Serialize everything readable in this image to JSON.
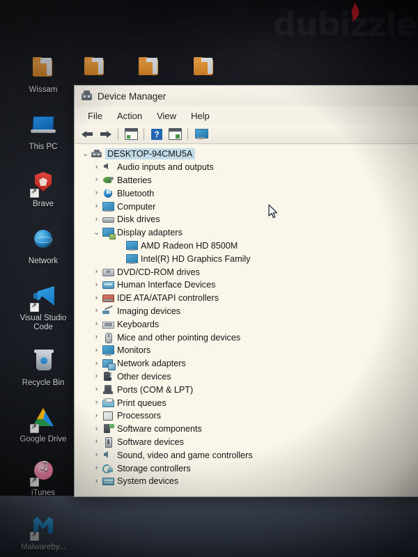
{
  "watermark": {
    "text": "dubizzle"
  },
  "desktop": {
    "top_folders": [
      {
        "name": "folder-icon-1",
        "label": ""
      },
      {
        "name": "folder-icon-2",
        "label": ""
      },
      {
        "name": "folder-icon-3",
        "label": ""
      },
      {
        "name": "folder-icon-4",
        "label": ""
      }
    ],
    "icons": [
      {
        "label": "Wissam",
        "icon": "folder-icon",
        "shortcut": false
      },
      {
        "label": "This PC",
        "icon": "this-pc-icon",
        "shortcut": false
      },
      {
        "label": "Brave",
        "icon": "brave-browser-icon",
        "shortcut": true
      },
      {
        "label": "Network",
        "icon": "network-icon",
        "shortcut": false
      },
      {
        "label": "Visual Studio Code",
        "icon": "visual-studio-code-icon",
        "shortcut": true
      },
      {
        "label": "Recycle Bin",
        "icon": "recycle-bin-icon",
        "shortcut": false
      },
      {
        "label": "Google Drive",
        "icon": "google-drive-icon",
        "shortcut": true
      },
      {
        "label": "iTunes",
        "icon": "itunes-icon",
        "shortcut": true
      },
      {
        "label": "Malwareby...",
        "icon": "malwarebytes-icon",
        "shortcut": true
      }
    ]
  },
  "window": {
    "title": "Device Manager",
    "title_icon": "device-manager-icon",
    "menu": [
      {
        "label": "File"
      },
      {
        "label": "Action"
      },
      {
        "label": "View"
      },
      {
        "label": "Help"
      }
    ],
    "toolbar": [
      {
        "name": "back-arrow-icon",
        "glyph": "back"
      },
      {
        "name": "forward-arrow-icon",
        "glyph": "forward"
      },
      {
        "name": "toolbar-separator-1",
        "glyph": "sep"
      },
      {
        "name": "properties-icon",
        "glyph": "props"
      },
      {
        "name": "toolbar-separator-2",
        "glyph": "sep"
      },
      {
        "name": "help-icon",
        "glyph": "help",
        "text": "?"
      },
      {
        "name": "update-driver-icon",
        "glyph": "update"
      },
      {
        "name": "toolbar-separator-3",
        "glyph": "sep"
      },
      {
        "name": "scan-hardware-changes-icon",
        "glyph": "scan"
      }
    ]
  },
  "tree": {
    "root": {
      "label": "DESKTOP-94CMU5A",
      "icon": "computer-root-icon",
      "expanded": true,
      "selected": true
    },
    "nodes": [
      {
        "label": "Audio inputs and outputs",
        "icon": "g-speaker",
        "expanded": false,
        "level": 1
      },
      {
        "label": "Batteries",
        "icon": "g-battery",
        "expanded": false,
        "level": 1
      },
      {
        "label": "Bluetooth",
        "icon": "g-bt",
        "expanded": false,
        "level": 1
      },
      {
        "label": "Computer",
        "icon": "g-computer",
        "expanded": false,
        "level": 1
      },
      {
        "label": "Disk drives",
        "icon": "g-disk",
        "expanded": false,
        "level": 1
      },
      {
        "label": "Display adapters",
        "icon": "g-dispadp",
        "expanded": true,
        "level": 1
      },
      {
        "label": "AMD Radeon HD 8500M",
        "icon": "g-monitor",
        "expanded": null,
        "level": 2
      },
      {
        "label": "Intel(R) HD Graphics Family",
        "icon": "g-monitor",
        "expanded": null,
        "level": 2
      },
      {
        "label": "DVD/CD-ROM drives",
        "icon": "g-dvd",
        "expanded": false,
        "level": 1
      },
      {
        "label": "Human Interface Devices",
        "icon": "g-hid",
        "expanded": false,
        "level": 1
      },
      {
        "label": "IDE ATA/ATAPI controllers",
        "icon": "g-ide",
        "expanded": false,
        "level": 1
      },
      {
        "label": "Imaging devices",
        "icon": "g-imaging",
        "expanded": false,
        "level": 1
      },
      {
        "label": "Keyboards",
        "icon": "g-keyboard",
        "expanded": false,
        "level": 1
      },
      {
        "label": "Mice and other pointing devices",
        "icon": "g-mouse",
        "expanded": false,
        "level": 1
      },
      {
        "label": "Monitors",
        "icon": "g-monitor",
        "expanded": false,
        "level": 1
      },
      {
        "label": "Network adapters",
        "icon": "g-netadp",
        "expanded": false,
        "level": 1
      },
      {
        "label": "Other devices",
        "icon": "g-other",
        "expanded": false,
        "level": 1
      },
      {
        "label": "Ports (COM & LPT)",
        "icon": "g-port",
        "expanded": false,
        "level": 1
      },
      {
        "label": "Print queues",
        "icon": "g-printq",
        "expanded": false,
        "level": 1
      },
      {
        "label": "Processors",
        "icon": "g-proc",
        "expanded": false,
        "level": 1
      },
      {
        "label": "Software components",
        "icon": "g-softcomp",
        "expanded": false,
        "level": 1
      },
      {
        "label": "Software devices",
        "icon": "g-softdev",
        "expanded": false,
        "level": 1
      },
      {
        "label": "Sound, video and game controllers",
        "icon": "g-sound",
        "expanded": false,
        "level": 1
      },
      {
        "label": "Storage controllers",
        "icon": "g-storage",
        "expanded": false,
        "level": 1
      },
      {
        "label": "System devices",
        "icon": "g-sysdev",
        "expanded": false,
        "level": 1
      }
    ],
    "chevron_collapsed": "›",
    "chevron_expanded": "⌄"
  },
  "colors": {
    "selection": "#bcdcf2",
    "window_bg": "#f7f6f0",
    "toolbar_bg": "#f1f0ec",
    "desktop_bg": "#1b1e25",
    "accent_blue": "#1d7ebd",
    "watermark": "#77777f"
  }
}
